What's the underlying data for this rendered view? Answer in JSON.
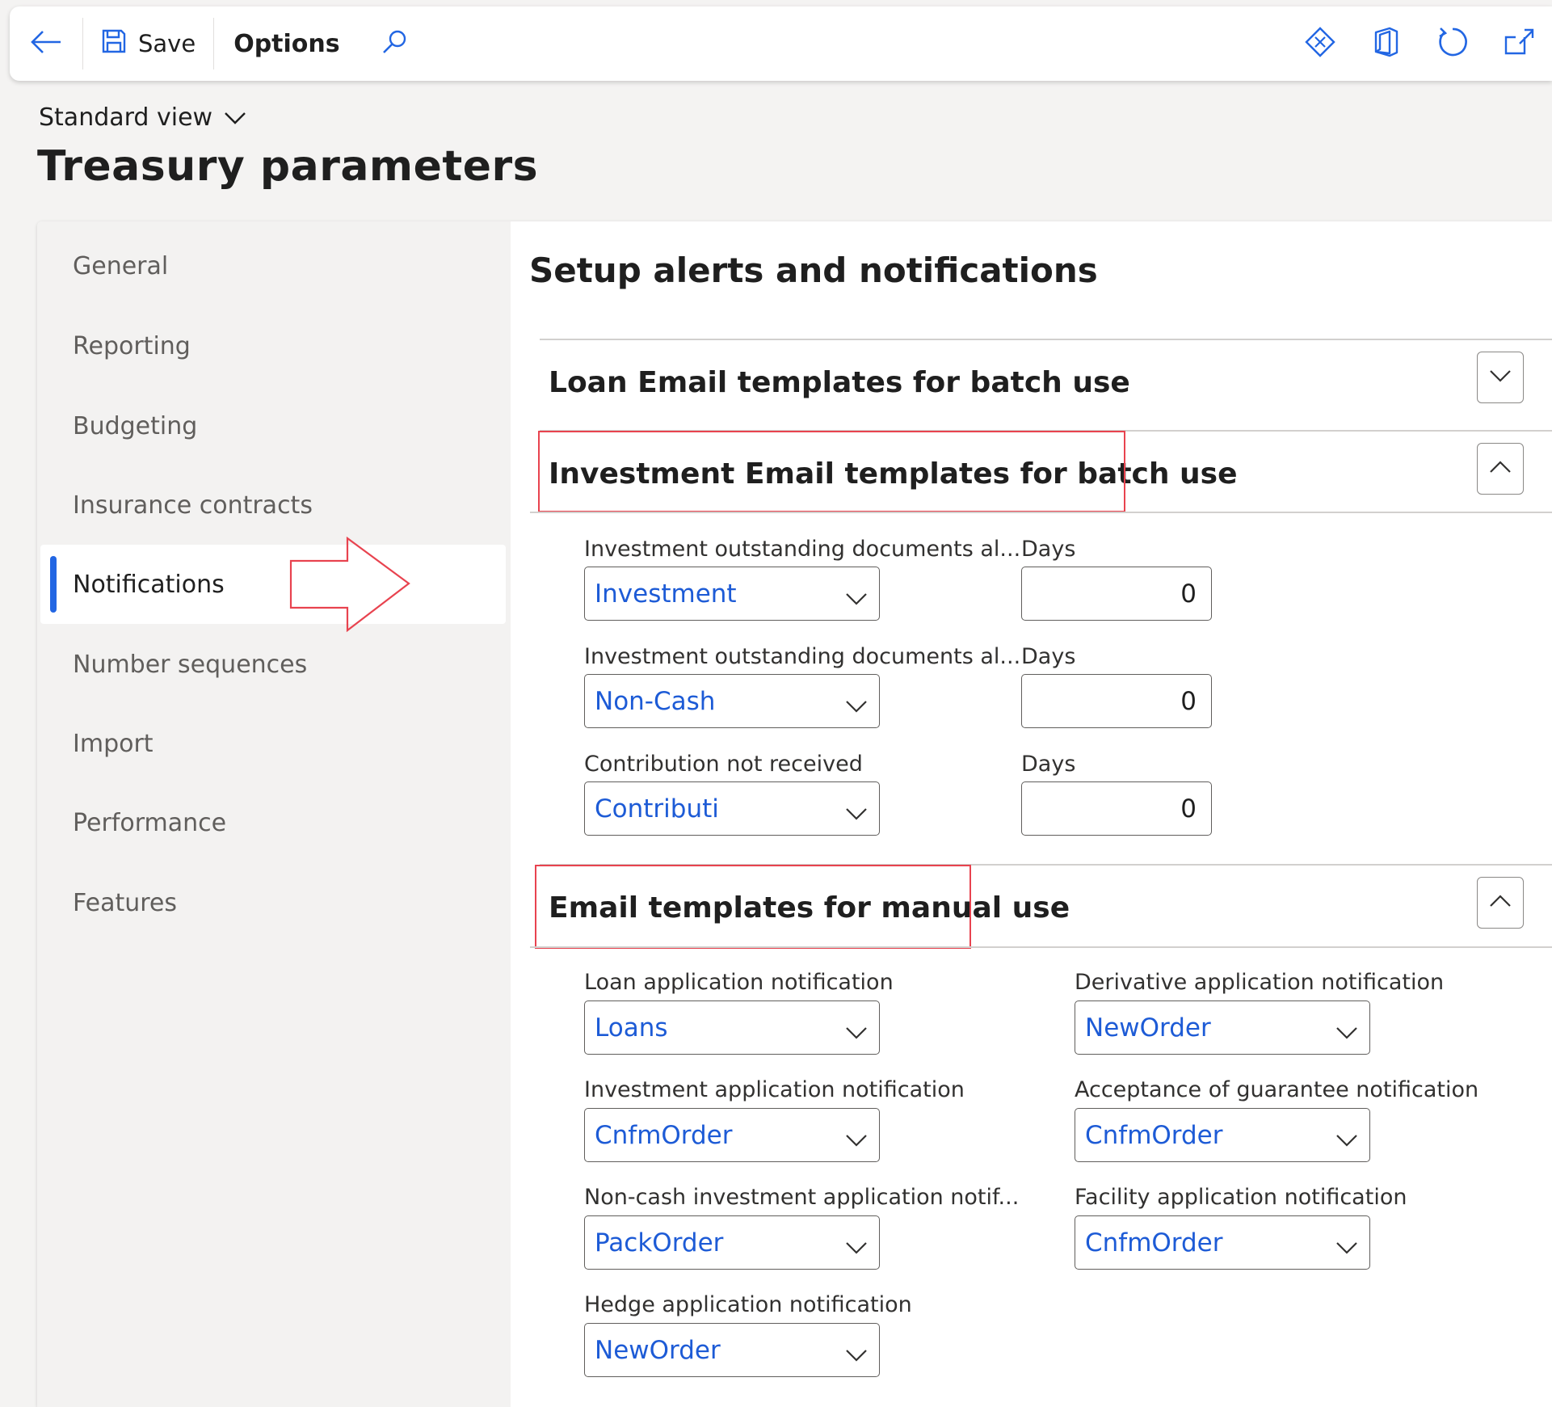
{
  "toolbar": {
    "save_label": "Save",
    "options_label": "Options",
    "icons": [
      "back-arrow-icon",
      "save-icon",
      "search-icon",
      "diamond-icon",
      "office-icon",
      "refresh-icon",
      "open-new-window-icon"
    ]
  },
  "view": {
    "label": "Standard view"
  },
  "page": {
    "title": "Treasury parameters"
  },
  "nav": {
    "items": [
      {
        "label": "General"
      },
      {
        "label": "Reporting"
      },
      {
        "label": "Budgeting"
      },
      {
        "label": "Insurance contracts"
      },
      {
        "label": "Notifications",
        "active": true
      },
      {
        "label": "Number sequences"
      },
      {
        "label": "Import"
      },
      {
        "label": "Performance"
      },
      {
        "label": "Features"
      }
    ]
  },
  "content": {
    "title": "Setup alerts and notifications",
    "groups": [
      {
        "title": "Loan Email templates for batch use",
        "state": "collapsed"
      },
      {
        "title": "Investment Email templates for batch use",
        "state": "expanded",
        "rows": [
          {
            "label": "Investment outstanding documents al...",
            "value": "Investment",
            "days_label": "Days",
            "days": "0"
          },
          {
            "label": "Investment outstanding documents al...",
            "value": "Non-Cash",
            "days_label": "Days",
            "days": "0"
          },
          {
            "label": "Contribution not received",
            "value": "Contributi",
            "days_label": "Days",
            "days": "0"
          }
        ]
      },
      {
        "title": "Email templates for manual use",
        "state": "expanded",
        "left": [
          {
            "label": "Loan application notification",
            "value": "Loans"
          },
          {
            "label": "Investment application notification",
            "value": "CnfmOrder"
          },
          {
            "label": "Non-cash investment application notif...",
            "value": "PackOrder"
          },
          {
            "label": "Hedge application notification",
            "value": "NewOrder"
          }
        ],
        "right": [
          {
            "label": "Derivative application notification",
            "value": "NewOrder"
          },
          {
            "label": "Acceptance of guarantee notification",
            "value": "CnfmOrder"
          },
          {
            "label": "Facility application notification",
            "value": "CnfmOrder"
          }
        ]
      }
    ]
  },
  "colors": {
    "accent": "#2266e3",
    "link_text": "#1d5bd6",
    "annotation": "#e8434f",
    "background": "#f4f3f2"
  }
}
